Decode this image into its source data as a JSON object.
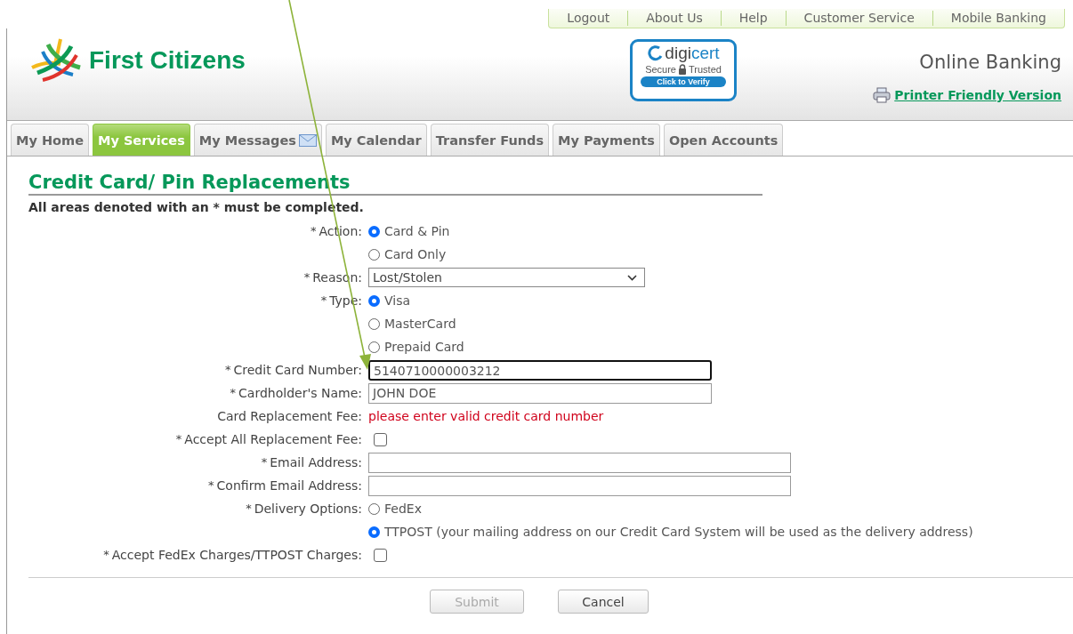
{
  "top_links": [
    "Logout",
    "About Us",
    "Help",
    "Customer Service",
    "Mobile Banking"
  ],
  "logo": {
    "name": "First Citizens"
  },
  "security_seal": {
    "brand_prefix": "digi",
    "brand_suffix": "cert",
    "left_word": "Secure",
    "right_word": "Trusted",
    "button": "Click to Verify"
  },
  "site_title": "Online Banking",
  "printer_link": "Printer Friendly Version",
  "tabs": [
    {
      "label": "My Home",
      "selected": false
    },
    {
      "label": "My Services",
      "selected": true
    },
    {
      "label": "My Messages",
      "selected": false,
      "mail_icon": true
    },
    {
      "label": "My Calendar",
      "selected": false
    },
    {
      "label": "Transfer Funds",
      "selected": false
    },
    {
      "label": "My Payments",
      "selected": false
    },
    {
      "label": "Open Accounts",
      "selected": false
    }
  ],
  "page": {
    "title": "Credit Card/ Pin Replacements",
    "note": "All areas denoted with an * must be completed."
  },
  "form": {
    "rows": [
      {
        "kind": "radio",
        "mark": "*",
        "label": "Action:",
        "options": [
          {
            "label": "Card & Pin",
            "selected": true
          },
          {
            "label": "Card Only",
            "selected": false
          }
        ]
      },
      {
        "kind": "select",
        "mark": "*",
        "label": "Reason:",
        "value": "Lost/Stolen"
      },
      {
        "kind": "radio",
        "mark": "*",
        "label": "Type:",
        "options": [
          {
            "label": "Visa",
            "selected": true
          },
          {
            "label": "MasterCard",
            "selected": false
          },
          {
            "label": "Prepaid Card",
            "selected": false
          }
        ]
      },
      {
        "kind": "text",
        "mark": "*",
        "label": "Credit Card Number:",
        "value": "5140710000003212",
        "focused": true
      },
      {
        "kind": "text",
        "mark": "*",
        "label": "Cardholder's Name:",
        "value": "JOHN DOE",
        "focused": false
      },
      {
        "kind": "error",
        "label": "Card Replacement Fee:",
        "value": "please enter valid credit card number"
      },
      {
        "kind": "checkbox",
        "mark": "*",
        "label": "Accept All Replacement Fee:",
        "checked": false
      },
      {
        "kind": "email",
        "mark": "*",
        "label": "Email Address:",
        "focused": false
      },
      {
        "kind": "email",
        "mark": "*",
        "label": "Confirm Email Address:",
        "focused": false
      },
      {
        "kind": "radio",
        "mark": "*",
        "label": "Delivery Options:",
        "options": [
          {
            "label": "FedEx",
            "selected": false
          },
          {
            "label": "TTPOST (your mailing address on our Credit Card System will be used as the delivery address)",
            "selected": true
          }
        ]
      },
      {
        "kind": "checkbox",
        "mark": "*",
        "label": "Accept FedEx Charges/TTPOST Charges:",
        "checked": false
      }
    ]
  },
  "buttons": [
    {
      "label": "Submit",
      "disabled": true
    },
    {
      "label": "Cancel",
      "disabled": false
    }
  ]
}
